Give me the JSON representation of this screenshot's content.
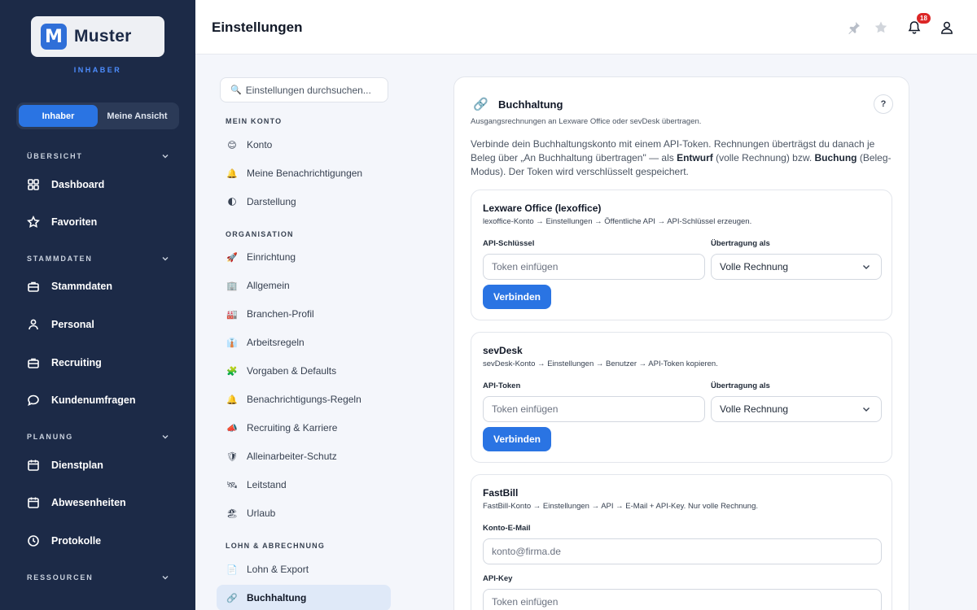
{
  "brand": {
    "logo_letter": "M",
    "name": "Muster",
    "role": "INHABER"
  },
  "view_toggle": {
    "owner": "Inhaber",
    "mine": "Meine Ansicht"
  },
  "sidebar": {
    "sections": {
      "overview": "ÜBERSICHT",
      "master": "STAMMDATEN",
      "planning": "PLANUNG",
      "resources": "RESSOURCEN"
    },
    "items": {
      "dashboard": "Dashboard",
      "favorites": "Favoriten",
      "masterdata": "Stammdaten",
      "staff": "Personal",
      "recruiting": "Recruiting",
      "surveys": "Kundenumfragen",
      "schedule": "Dienstplan",
      "absences": "Abwesenheiten",
      "logs": "Protokolle"
    }
  },
  "header": {
    "title": "Einstellungen",
    "notification_count": "18"
  },
  "settings_nav": {
    "search_placeholder": "Einstellungen durchsuchen...",
    "groups": [
      {
        "title": "MEIN KONTO",
        "items": [
          {
            "icon": "😊",
            "label": "Konto"
          },
          {
            "icon": "🔔",
            "label": "Meine Benachrichtigungen"
          },
          {
            "icon": "🌓",
            "label": "Darstellung"
          }
        ]
      },
      {
        "title": "ORGANISATION",
        "items": [
          {
            "icon": "🚀",
            "label": "Einrichtung"
          },
          {
            "icon": "🏢",
            "label": "Allgemein"
          },
          {
            "icon": "🏭",
            "label": "Branchen-Profil"
          },
          {
            "icon": "👔",
            "label": "Arbeitsregeln"
          },
          {
            "icon": "🧩",
            "label": "Vorgaben & Defaults"
          },
          {
            "icon": "🔔",
            "label": "Benachrichtigungs-Regeln"
          },
          {
            "icon": "📣",
            "label": "Recruiting & Karriere"
          },
          {
            "icon": "🛡",
            "label": "Alleinarbeiter-Schutz"
          },
          {
            "icon": "🛰",
            "label": "Leitstand"
          },
          {
            "icon": "🏖",
            "label": "Urlaub"
          }
        ]
      },
      {
        "title": "LOHN & ABRECHNUNG",
        "items": [
          {
            "icon": "📄",
            "label": "Lohn & Export"
          },
          {
            "icon": "🔗",
            "label": "Buchhaltung"
          }
        ]
      }
    ]
  },
  "panel": {
    "icon": "🔗",
    "title": "Buchhaltung",
    "help": "?",
    "subtitle": "Ausgangsrechnungen an Lexware Office oder sevDesk übertragen.",
    "desc_1": "Verbinde dein Buchhaltungskonto mit einem API-Token. Rechnungen überträgst du danach je Beleg über „An Buchhaltung übertragen\" — als ",
    "desc_bold_1": "Entwurf",
    "desc_2": " (volle Rechnung) bzw. ",
    "desc_bold_2": "Buchung",
    "desc_3": " (Beleg-Modus). Der Token wird verschlüsselt gespeichert.",
    "lexware": {
      "title": "Lexware Office (lexoffice)",
      "hint": "lexoffice-Konto → Einstellungen → Öffentliche API → API-Schlüssel erzeugen.",
      "key_label": "API-Schlüssel",
      "key_placeholder": "Token einfügen",
      "mode_label": "Übertragung als",
      "mode_value": "Volle Rechnung",
      "connect": "Verbinden"
    },
    "sevdesk": {
      "title": "sevDesk",
      "hint": "sevDesk-Konto → Einstellungen → Benutzer → API-Token kopieren.",
      "key_label": "API-Token",
      "key_placeholder": "Token einfügen",
      "mode_label": "Übertragung als",
      "mode_value": "Volle Rechnung",
      "connect": "Verbinden"
    },
    "fastbill": {
      "title": "FastBill",
      "hint": "FastBill-Konto → Einstellungen → API → E-Mail + API-Key. Nur volle Rechnung.",
      "email_label": "Konto-E-Mail",
      "email_placeholder": "konto@firma.de",
      "key_label": "API-Key",
      "key_placeholder": "Token einfügen"
    }
  },
  "colors": {
    "sidebar_bg": "#1c2a47",
    "accent": "#2a74e3",
    "badge": "#dc2626",
    "active_nav": "#dfe9f8"
  }
}
